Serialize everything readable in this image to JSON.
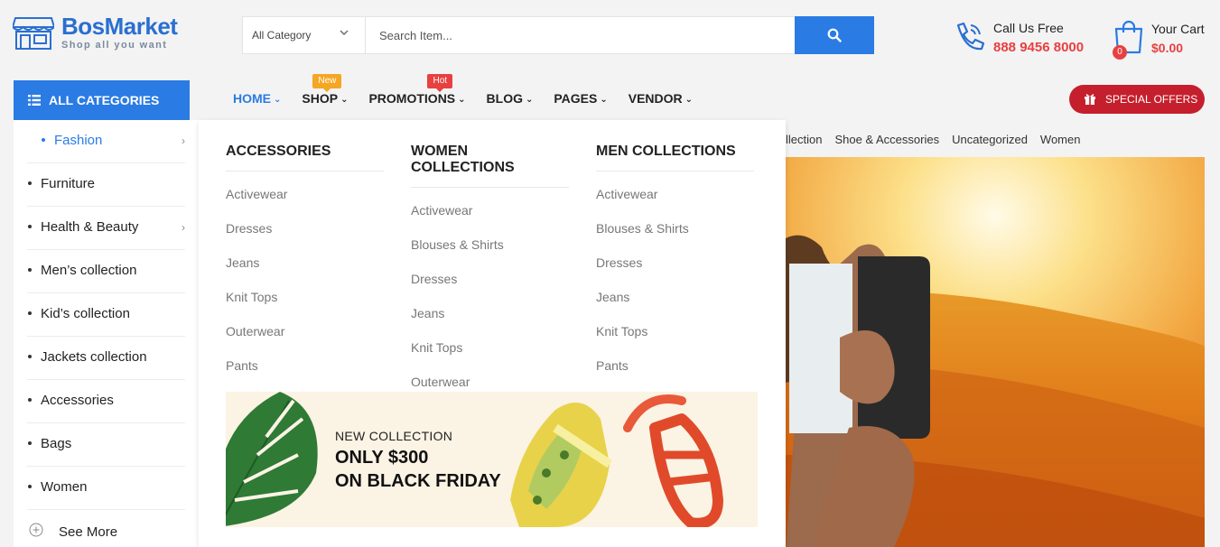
{
  "header": {
    "brand": "BosMarket",
    "tagline": "Shop all you want",
    "category_select": "All Category",
    "search_placeholder": "Search Item...",
    "call_label": "Call Us Free",
    "call_number": "888 9456 8000",
    "cart_label": "Your Cart",
    "cart_amount": "$0.00",
    "cart_count": "0"
  },
  "nav": {
    "all_categories": "ALL CATEGORIES",
    "items": [
      {
        "label": "HOME"
      },
      {
        "label": "SHOP",
        "badge": "New"
      },
      {
        "label": "PROMOTIONS",
        "badge": "Hot"
      },
      {
        "label": "BLOG"
      },
      {
        "label": "PAGES"
      },
      {
        "label": "VENDOR"
      }
    ],
    "special_offers": "SPECIAL OFFERS"
  },
  "sidebar": {
    "items": [
      {
        "label": "Fashion"
      },
      {
        "label": "Furniture"
      },
      {
        "label": "Health & Beauty"
      },
      {
        "label": "Men’s collection"
      },
      {
        "label": "Kid’s collection"
      },
      {
        "label": "Jackets collection"
      },
      {
        "label": "Accessories"
      },
      {
        "label": "Bags"
      },
      {
        "label": "Women"
      }
    ],
    "see_more": "See More"
  },
  "megamenu": {
    "columns": [
      {
        "title": "ACCESSORIES",
        "links": [
          "Activewear",
          "Dresses",
          "Jeans",
          "Knit Tops",
          "Outerwear",
          "Pants"
        ]
      },
      {
        "title": "WOMEN COLLECTIONS",
        "links": [
          "Activewear",
          "Blouses & Shirts",
          "Dresses",
          "Jeans",
          "Knit Tops",
          "Outerwear"
        ]
      },
      {
        "title": "MEN COLLECTIONS",
        "links": [
          "Activewear",
          "Blouses & Shirts",
          "Dresses",
          "Jeans",
          "Knit Tops",
          "Pants"
        ]
      }
    ],
    "banner": {
      "line1": "NEW COLLECTION",
      "line2": "ONLY $300",
      "line3": "ON BLACK FRIDAY"
    }
  },
  "category_strip": [
    "llection",
    "Shoe & Accessories",
    "Uncategorized",
    "Women"
  ],
  "colors": {
    "accent": "#2a7be4",
    "price": "#e84040",
    "special": "#c51f2d",
    "new_badge": "#f5a623",
    "hot_badge": "#e84040"
  }
}
